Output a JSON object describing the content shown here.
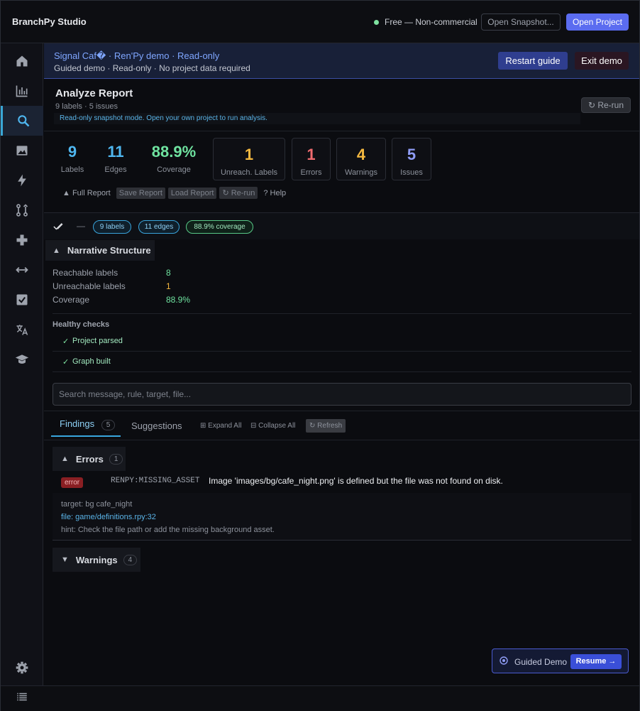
{
  "app": {
    "title": "BranchPy Studio",
    "license": "Free — Non-commercial",
    "open_snapshot": "Open Snapshot...",
    "open_project": "Open Project"
  },
  "banner": {
    "title": "Signal Caf� · Ren'Py demo · Read-only",
    "subtitle": "Guided demo · Read-only · No project data required",
    "restart": "Restart guide",
    "exit": "Exit demo"
  },
  "report": {
    "title": "Analyze Report",
    "subtitle": "9 labels · 5 issues",
    "note": "Read-only snapshot mode. Open your own project to run analysis.",
    "rerun": "↻ Re-run"
  },
  "stats": [
    {
      "value": "9",
      "label": "Labels",
      "color": "#4fb7f0"
    },
    {
      "value": "11",
      "label": "Edges",
      "color": "#4fb7f0"
    },
    {
      "value": "88.9%",
      "label": "Coverage",
      "color": "#6fe3a0"
    }
  ],
  "cards": [
    {
      "value": "1",
      "label": "Unreach. Labels",
      "color": "#f5b940"
    },
    {
      "value": "1",
      "label": "Errors",
      "color": "#ef6b6f"
    },
    {
      "value": "4",
      "label": "Warnings",
      "color": "#f5b940"
    },
    {
      "value": "5",
      "label": "Issues",
      "color": "#8f9cf5"
    }
  ],
  "actions": {
    "full_report": "▲ Full Report",
    "save": "Save Report",
    "load": "Load Report",
    "rerun": "↻ Re-run",
    "help": "? Help"
  },
  "filters": {
    "dash": "—",
    "labels": "9 labels",
    "edges": "11 edges",
    "coverage": "88.9% coverage"
  },
  "narrative": {
    "title": "Narrative Structure",
    "rows": [
      {
        "k": "Reachable labels",
        "v": "8",
        "color": "#6fe3a0"
      },
      {
        "k": "Unreachable labels",
        "v": "1",
        "color": "#f5b940"
      },
      {
        "k": "Coverage",
        "v": "88.9%",
        "color": "#6fe3a0"
      }
    ]
  },
  "healthy": {
    "title": "Healthy checks",
    "items": [
      "Project parsed",
      "Graph built"
    ]
  },
  "search": {
    "placeholder": "Search message, rule, target, file..."
  },
  "tabs": {
    "findings": "Findings",
    "findings_count": "5",
    "suggestions": "Suggestions",
    "expand_all": "⊞ Expand All",
    "collapse_all": "⊟ Collapse All",
    "refresh": "↻ Refresh"
  },
  "errors": {
    "title": "Errors",
    "count": "1",
    "finding": {
      "severity": "error",
      "rule": "RENPY:MISSING_ASSET",
      "message": "Image 'images/bg/cafe_night.png' is defined but the file was not found on disk.",
      "target": "target: bg cafe_night",
      "file": "file: game/definitions.rpy:32",
      "hint": "hint: Check the file path or add the missing background asset."
    }
  },
  "warnings": {
    "title": "Warnings",
    "count": "4"
  },
  "guide": {
    "label": "Guided Demo",
    "resume": "Resume →"
  }
}
